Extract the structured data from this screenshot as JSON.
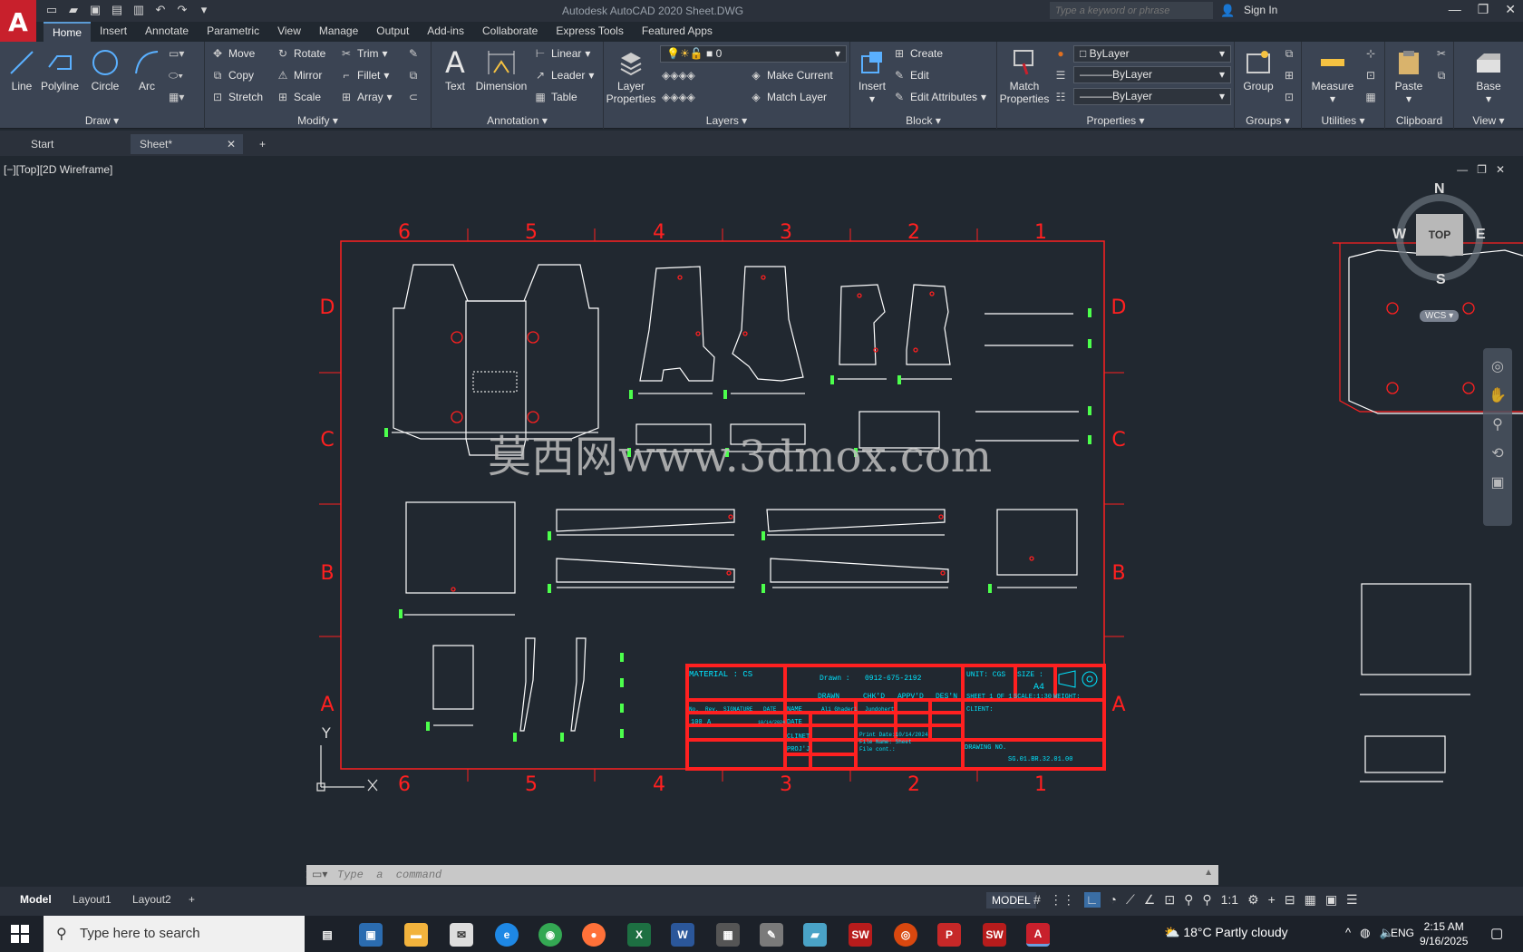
{
  "app": {
    "logo_letter": "A",
    "window_title": "Autodesk AutoCAD 2020    Sheet.DWG",
    "search_placeholder": "Type a keyword or phrase",
    "sign_in": "Sign In"
  },
  "menu_tabs": [
    "Home",
    "Insert",
    "Annotate",
    "Parametric",
    "View",
    "Manage",
    "Output",
    "Add-ins",
    "Collaborate",
    "Express Tools",
    "Featured Apps"
  ],
  "ribbon": {
    "draw": {
      "title": "Draw",
      "line": "Line",
      "polyline": "Polyline",
      "circle": "Circle",
      "arc": "Arc"
    },
    "modify": {
      "title": "Modify",
      "move": "Move",
      "rotate": "Rotate",
      "trim": "Trim",
      "copy": "Copy",
      "mirror": "Mirror",
      "fillet": "Fillet",
      "stretch": "Stretch",
      "scale": "Scale",
      "array": "Array"
    },
    "annotation": {
      "title": "Annotation",
      "text": "Text",
      "dimension": "Dimension",
      "linear": "Linear",
      "leader": "Leader",
      "table": "Table"
    },
    "layers": {
      "title": "Layers",
      "layer_properties": "Layer Properties",
      "current_layer": "0",
      "make_current": "Make Current",
      "match_layer": "Match Layer"
    },
    "block": {
      "title": "Block",
      "insert": "Insert",
      "create": "Create",
      "edit": "Edit",
      "edit_attributes": "Edit Attributes"
    },
    "properties": {
      "title": "Properties",
      "match_properties": "Match Properties",
      "color": "ByLayer",
      "linetype": "ByLayer",
      "lineweight": "ByLayer"
    },
    "groups": {
      "title": "Groups",
      "group": "Group"
    },
    "utilities": {
      "title": "Utilities",
      "measure": "Measure"
    },
    "clipboard": {
      "title": "Clipboard",
      "paste": "Paste"
    },
    "view": {
      "title": "View",
      "base": "Base"
    }
  },
  "file_tabs": {
    "start": "Start",
    "sheet": "Sheet*"
  },
  "viewport": {
    "label": "[−][Top][2D Wireframe]",
    "viewcube": {
      "top": "TOP",
      "n": "N",
      "s": "S",
      "e": "E",
      "w": "W",
      "wcs": "WCS"
    },
    "grid_cols": [
      "6",
      "5",
      "4",
      "3",
      "2",
      "1"
    ],
    "grid_rows": [
      "D",
      "C",
      "B",
      "A"
    ],
    "watermark": "莫西网www.3dmox.com",
    "ucs_y": "Y",
    "title_block": {
      "material": "MATERIAL : CS",
      "drawn_label": "Drawn :",
      "drawn_value": "0912-675-2192",
      "unit": "UNIT: CGS",
      "size_label": "SIZE :",
      "size_value": "A4",
      "drawn": "DRAWN",
      "chkd": "CHK'D",
      "appvd": "APPV'D",
      "desn": "DES'N",
      "sheet": "SHEET 1 OF 1",
      "scale": "SCALE:1:30",
      "weight": "WEIGHT:",
      "no": "No.",
      "rev": "Rev.",
      "signature": "SIGNATURE",
      "date": "DATE",
      "name": "NAME",
      "date2": "DATE",
      "client_label": "CLIENT:",
      "clinet": "CLINET",
      "projet": "PROJ'J",
      "row_no": "100",
      "row_rev": "A",
      "row_date": "10/14/2024",
      "name_value1": "Ali Ghaderi",
      "name_value2": "Jundohert",
      "print_date": "Print Date:10/14/2024",
      "file_name": "File Name: Sheet",
      "file_cont": "File cont.:",
      "drawing_no": "DRAWING NO.",
      "drawing_value": "SG.01.BR.32.01.00"
    }
  },
  "command": {
    "placeholder": "Type  a  command"
  },
  "layout_tabs": [
    "Model",
    "Layout1",
    "Layout2"
  ],
  "status": {
    "model": "MODEL",
    "scale": "1:1"
  },
  "taskbar": {
    "search": "Type here to search",
    "weather": "18°C  Partly cloudy",
    "lang": "ENG",
    "time": "2:15 AM",
    "date": "9/16/2025"
  },
  "colors": {
    "accent": "#c8202c",
    "cad_red": "#ff2020",
    "cad_cyan": "#00e5ff",
    "cad_green": "#4cff4c",
    "ribbon": "#3b4453",
    "bg": "#212830"
  }
}
